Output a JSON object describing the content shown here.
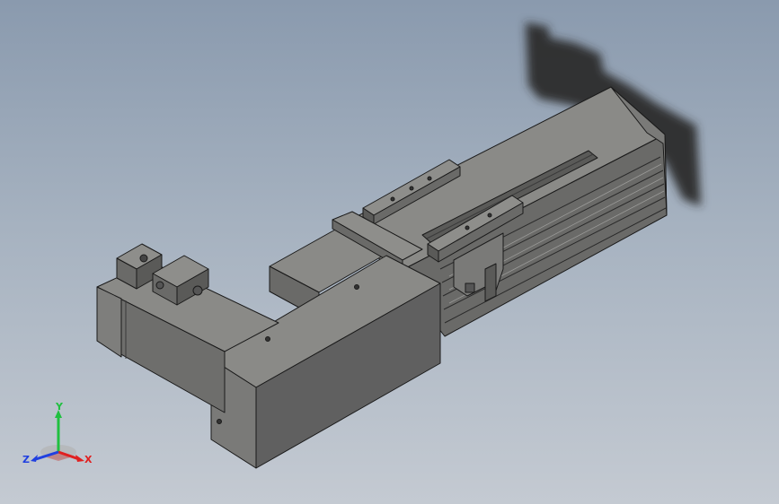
{
  "viewport": {
    "background_top": "#8a9aae",
    "background_bottom": "#c4cad2"
  },
  "model": {
    "body_color": "#6e6e6c",
    "face_light": "#8a8a87",
    "face_dark": "#4e4e4d",
    "edge_color": "#1a1a1a",
    "shadow_color": "#2e2e2e"
  },
  "triad": {
    "x_label": "X",
    "y_label": "Y",
    "z_label": "Z",
    "x_color": "#e02020",
    "y_color": "#20c040",
    "z_color": "#2040e0"
  }
}
